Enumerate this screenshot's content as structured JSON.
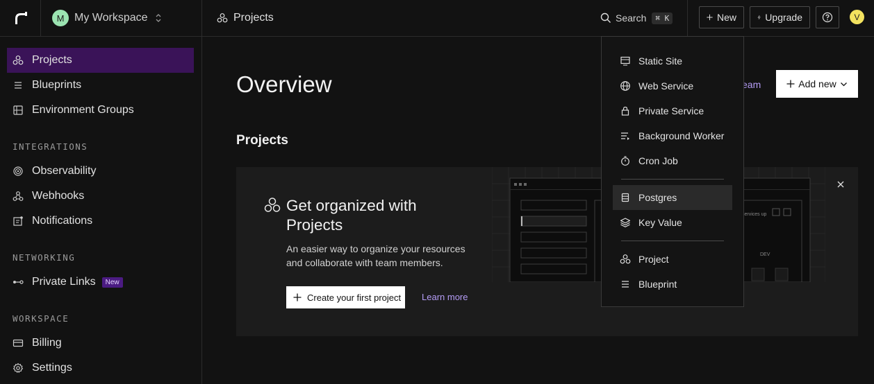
{
  "topbar": {
    "workspace_initial": "M",
    "workspace_name": "My Workspace",
    "breadcrumb": "Projects",
    "search_label": "Search",
    "search_shortcut": "⌘ K",
    "new_label": "New",
    "upgrade_label": "Upgrade",
    "user_initial": "V"
  },
  "sidebar": {
    "items_top": [
      {
        "label": "Projects",
        "icon": "projects-icon",
        "active": true
      },
      {
        "label": "Blueprints",
        "icon": "list-icon"
      },
      {
        "label": "Environment Groups",
        "icon": "env-groups-icon"
      }
    ],
    "integrations_label": "INTEGRATIONS",
    "integrations": [
      {
        "label": "Observability",
        "icon": "observability-icon"
      },
      {
        "label": "Webhooks",
        "icon": "webhooks-icon"
      },
      {
        "label": "Notifications",
        "icon": "notifications-icon"
      }
    ],
    "networking_label": "NETWORKING",
    "networking": [
      {
        "label": "Private Links",
        "icon": "link-icon",
        "badge": "New"
      }
    ],
    "workspace_label": "WORKSPACE",
    "workspace": [
      {
        "label": "Billing",
        "icon": "billing-icon"
      },
      {
        "label": "Settings",
        "icon": "gear-icon"
      }
    ]
  },
  "main": {
    "title": "Overview",
    "team_link_fragment": "eam",
    "add_new_label": "Add new",
    "projects_heading": "Projects",
    "card": {
      "title": "Get organized with Projects",
      "description": "An easier way to organize your resources and collaborate with team members.",
      "create_label": "Create your first project",
      "learn_more": "Learn more",
      "illustration_text_1": "services up",
      "illustration_text_2": "DEV"
    }
  },
  "dropdown": {
    "group1": [
      {
        "label": "Static Site",
        "icon": "static-site-icon"
      },
      {
        "label": "Web Service",
        "icon": "globe-icon"
      },
      {
        "label": "Private Service",
        "icon": "lock-icon"
      },
      {
        "label": "Background Worker",
        "icon": "worker-icon"
      },
      {
        "label": "Cron Job",
        "icon": "timer-icon"
      }
    ],
    "group2": [
      {
        "label": "Postgres",
        "icon": "database-icon",
        "hovered": true
      },
      {
        "label": "Key Value",
        "icon": "layers-icon"
      }
    ],
    "group3": [
      {
        "label": "Project",
        "icon": "projects-icon"
      },
      {
        "label": "Blueprint",
        "icon": "list-icon"
      }
    ]
  },
  "colors": {
    "background": "#121212",
    "active_nav": "#3a1358",
    "accent_link": "#b49cf5",
    "badge": "#4b1b82",
    "workspace_avatar": "#9be3b1",
    "user_avatar": "#f2e25f"
  }
}
